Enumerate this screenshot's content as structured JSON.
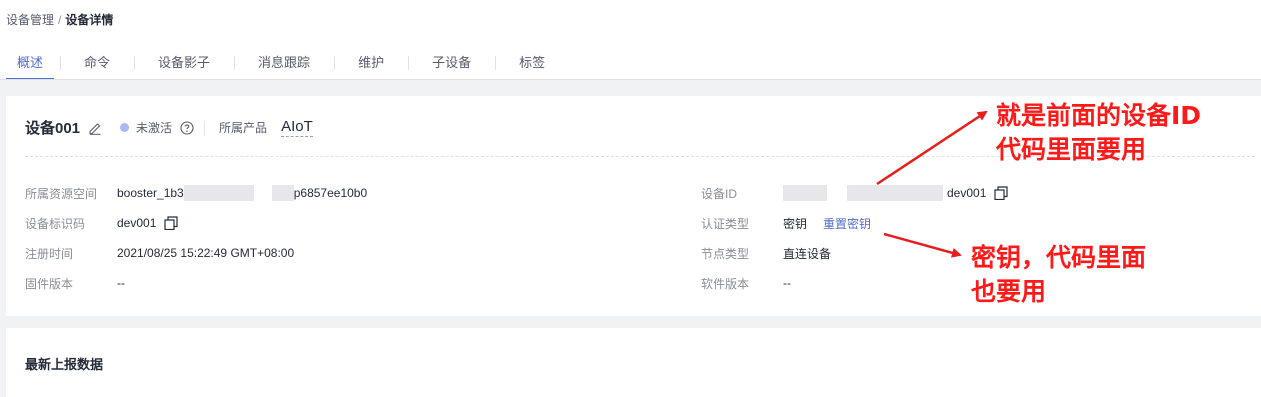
{
  "breadcrumb": {
    "parent": "设备管理",
    "separator": "/",
    "current": "设备详情"
  },
  "tabs": [
    "概述",
    "命令",
    "设备影子",
    "消息跟踪",
    "维护",
    "子设备",
    "标签"
  ],
  "active_tab": "概述",
  "device": {
    "name": "设备001",
    "status": "未激活",
    "product_label": "所属产品",
    "product_value": "AIoT"
  },
  "fields_left": [
    {
      "label": "所属资源空间",
      "value_prefix": "booster_1b3",
      "value_suffix": "p6857ee10b0"
    },
    {
      "label": "设备标识码",
      "value": "dev001"
    },
    {
      "label": "注册时间",
      "value": "2021/08/25 15:22:49 GMT+08:00"
    },
    {
      "label": "固件版本",
      "value": "--"
    }
  ],
  "fields_right": [
    {
      "label": "设备ID",
      "value_suffix": "dev001"
    },
    {
      "label": "认证类型",
      "value": "密钥",
      "link": "重置密钥"
    },
    {
      "label": "节点类型",
      "value": "直连设备"
    },
    {
      "label": "软件版本",
      "value": "--"
    }
  ],
  "section_latest": "最新上报数据",
  "annotations": {
    "device_id_line1": "就是前面的设备ID",
    "device_id_line2": "代码里面要用",
    "secret_line1": "密钥，代码里面",
    "secret_line2": "也要用",
    "color": "#ff1a1a"
  },
  "icons": {
    "edit": "pencil-icon",
    "help": "question-circle-icon",
    "copy": "copy-icon"
  },
  "colors": {
    "accent": "#526ecc",
    "status_dot": "#adb8f0"
  }
}
